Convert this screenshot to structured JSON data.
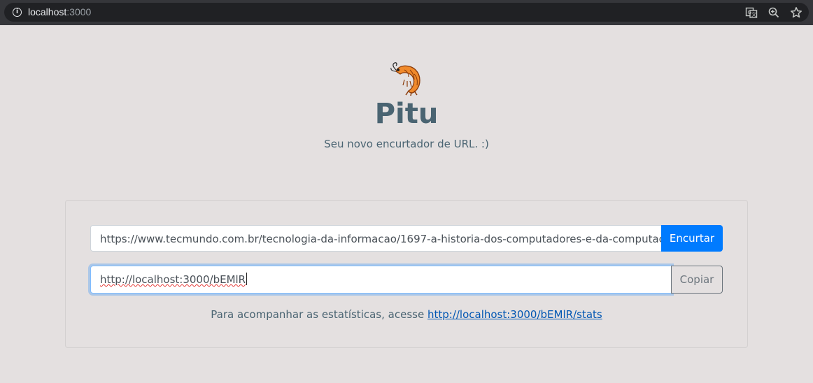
{
  "browser": {
    "url_host": "localhost",
    "url_port": ":3000",
    "icons": [
      "info-icon",
      "translate-icon",
      "zoom-icon",
      "bookmark-star-icon"
    ]
  },
  "header": {
    "logo_icon": "shrimp-icon",
    "title": "Pitu",
    "subtitle": "Seu novo encurtador de URL. :)"
  },
  "form": {
    "url_value": "https://www.tecmundo.com.br/tecnologia-da-informacao/1697-a-historia-dos-computadores-e-da-computac",
    "shorten_label": "Encurtar",
    "short_url_value": "http://localhost:3000/bEMlR",
    "copy_label": "Copiar",
    "stats_text": "Para acompanhar as estatísticas, acesse",
    "stats_link": "http://localhost:3000/bEMlR/stats"
  },
  "colors": {
    "background": "#e4e0e0",
    "primary": "#007bff",
    "heading": "#4a6472"
  }
}
